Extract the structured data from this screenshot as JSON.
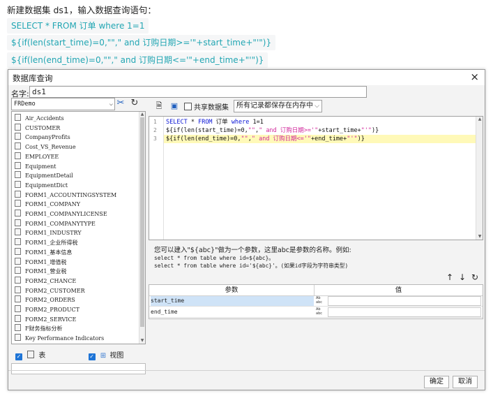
{
  "document": {
    "intro": "新建数据集 ds1，输入数据查询语句：",
    "code_lines": [
      "SELECT * FROM 订单 where 1=1",
      "${if(len(start_time)=0,\"\",\" and 订购日期>='\"+start_time+\"'\")}",
      "${if(len(end_time)=0,\"\",\" and 订购日期<='\"+end_time+\"'\")}"
    ]
  },
  "dialog": {
    "title": "数据库查询",
    "close_glyph": "×",
    "name_label": "名字:",
    "name_value": "ds1",
    "db_select": "FRDemo",
    "tables": [
      "Air_Accidents",
      "CUSTOMER",
      "CompanyProfits",
      "Cost_VS_Revenue",
      "EMPLOYEE",
      "Equipment",
      "EquipmentDetail",
      "EquipmentDict",
      "FORM1_ACCOUNTINGSYSTEM",
      "FORM1_COMPANY",
      "FORM1_COMPANYLICENSE",
      "FORM1_COMPANYTYPE",
      "FORM1_INDUSTRY",
      "FORM1_企业所得税",
      "FORM1_基本信息",
      "FORM1_增值税",
      "FORM1_营业税",
      "FORM2_CHANCE",
      "FORM2_CUSTOMER",
      "FORM2_ORDERS",
      "FORM2_PRODUCT",
      "FORM2_SERVICE",
      "F财务指标分析",
      "Key Performance Indicators"
    ],
    "check_table_label": "表",
    "check_view_label": "视图",
    "toolbar": {
      "share_label": "共享数据集",
      "memory_select": "所有记录都保存在内存中"
    },
    "editor": {
      "line_numbers": [
        "1",
        "2",
        "3"
      ],
      "l1": {
        "kw1": "SELECT",
        "op": " * ",
        "kw2": "FROM",
        "tbl": " 订单 ",
        "kw3": "where",
        "num": " 1=1"
      },
      "l2": {
        "a": "${if(len(start_time)=0,",
        "s1": "\"\"",
        "c": ",",
        "s2": "\" and 订购日期>='\"",
        "b": "+start_time+",
        "s3": "\"'\"",
        "d": ")}"
      },
      "l3": {
        "a": "${if(len(end_time)=0,",
        "s1": "\"\"",
        "c": ",",
        "s2": "\" and 订购日期<='\"",
        "b": "+end_time+",
        "s3": "\"'\"",
        "d": ")}"
      }
    },
    "hint": {
      "line1": "您可以建入\"${abc}\"做为一个参数，这里abc是参数的名称。例如:",
      "line2": "select * from table where id=${abc}。",
      "line3": "select * from table where id='${abc}'。(如果id字段为字符串类型)"
    },
    "params": {
      "col_name": "参数",
      "col_value": "值",
      "rows": [
        "start_time",
        "end_time"
      ]
    },
    "ok_label": "确定",
    "cancel_label": "取消"
  }
}
